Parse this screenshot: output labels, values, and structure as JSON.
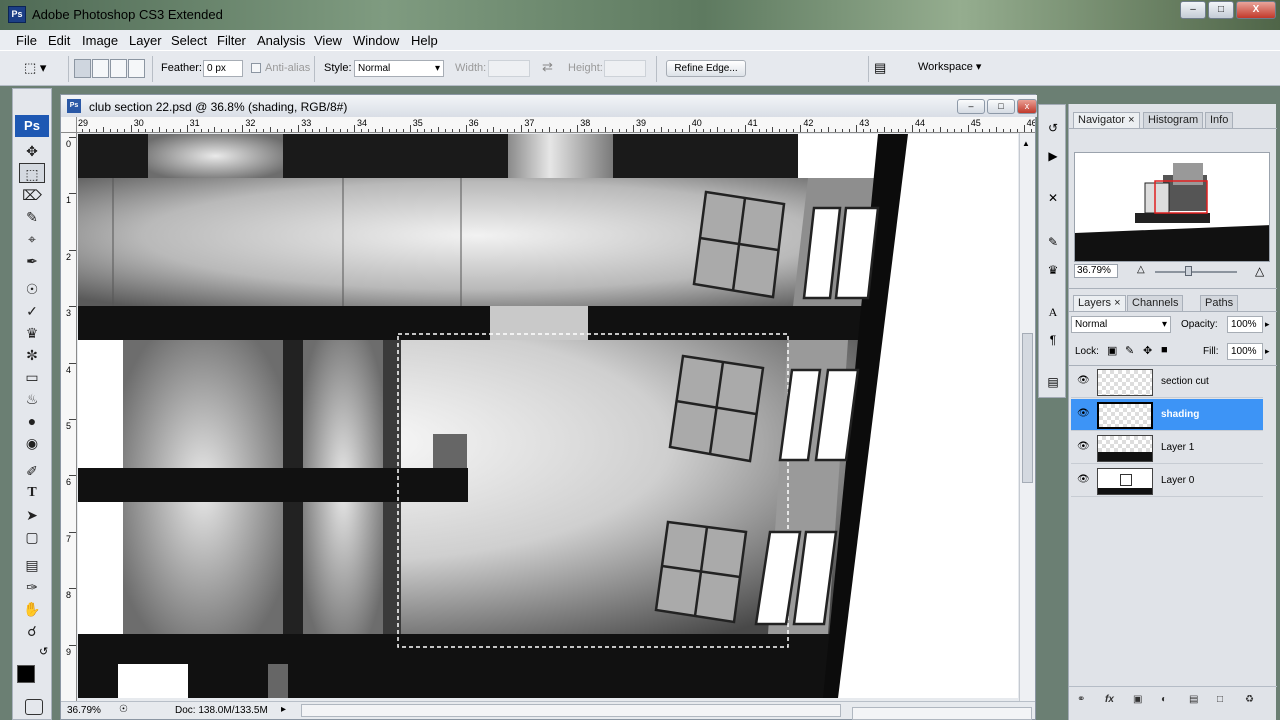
{
  "window": {
    "app_icon": "Ps",
    "title": "Adobe Photoshop CS3 Extended",
    "minimize": "‒",
    "restore": "□",
    "close": "X"
  },
  "menu": [
    "File",
    "Edit",
    "Image",
    "Layer",
    "Select",
    "Filter",
    "Analysis",
    "View",
    "Window",
    "Help"
  ],
  "options": {
    "feather_label": "Feather:",
    "feather_value": "0 px",
    "antialias_label": "Anti-alias",
    "style_label": "Style:",
    "style_value": "Normal",
    "width_label": "Width:",
    "height_label": "Height:",
    "refine_label": "Refine Edge...",
    "workspace_label": "Workspace ▾"
  },
  "toolbox": {
    "badge": "Ps"
  },
  "document": {
    "icon": "Ps",
    "title": "club section 22.psd @ 36.8% (shading, RGB/8#)",
    "zoom": "36.79%",
    "doc_size": "Doc: 138.0M/133.5M",
    "ruler_h": [
      "29",
      "30",
      "31",
      "32",
      "33",
      "34",
      "35",
      "36",
      "37",
      "38",
      "39",
      "40",
      "41",
      "42",
      "43",
      "44",
      "45",
      "46"
    ],
    "ruler_v": [
      "0",
      "1",
      "2",
      "3",
      "4",
      "5",
      "6",
      "7",
      "8",
      "9"
    ]
  },
  "navigator": {
    "tabs": [
      "Navigator ×",
      "Histogram",
      "Info"
    ],
    "zoom": "36.79%"
  },
  "layers_panel": {
    "tabs": [
      "Layers ×",
      "Channels",
      "Paths"
    ],
    "blend_mode": "Normal",
    "opacity_label": "Opacity:",
    "opacity_value": "100%",
    "lock_label": "Lock:",
    "fill_label": "Fill:",
    "fill_value": "100%",
    "layers": [
      {
        "name": "section cut",
        "visible": true,
        "selected": false
      },
      {
        "name": "shading",
        "visible": true,
        "selected": true
      },
      {
        "name": "Layer 1",
        "visible": true,
        "selected": false
      },
      {
        "name": "Layer 0",
        "visible": true,
        "selected": false
      }
    ],
    "bottom_icons": [
      "link-icon",
      "fx-icon",
      "mask-icon",
      "adjustment-icon",
      "group-icon",
      "new-layer-icon",
      "trash-icon"
    ]
  },
  "colors": {
    "accent": "#3d94f6",
    "selection_border": "#ffffff",
    "ps_blue": "#1e58b3"
  }
}
